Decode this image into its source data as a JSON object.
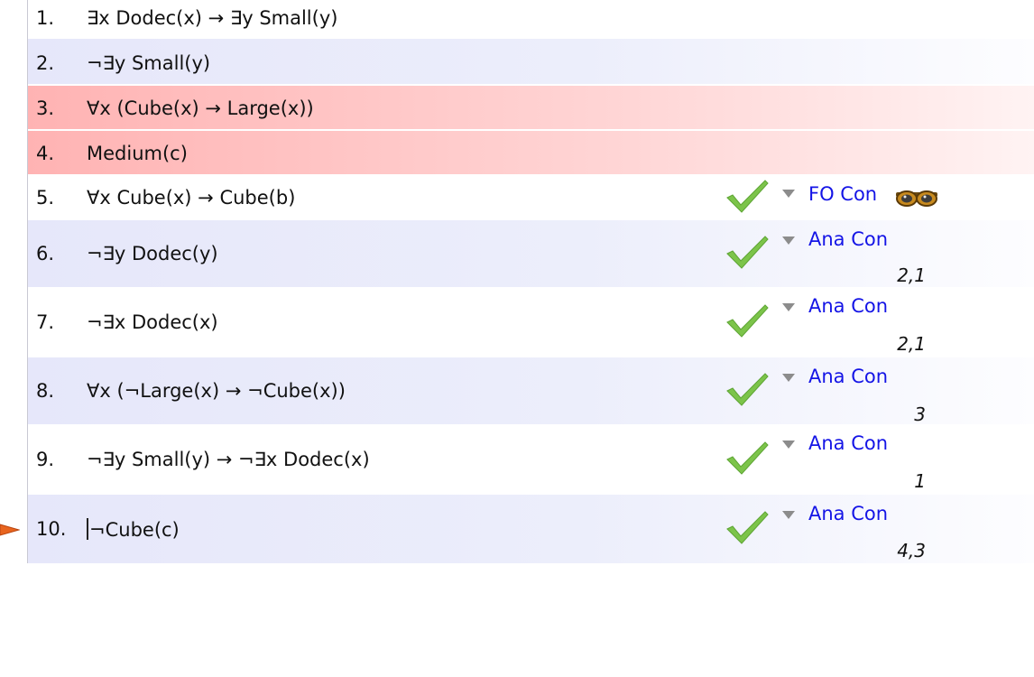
{
  "premises": [
    {
      "num": "1.",
      "sentence": "∃x Dodec(x) → ∃y Small(y)"
    },
    {
      "num": "2.",
      "sentence": "¬∃y Small(y)"
    },
    {
      "num": "3.",
      "sentence": "∀x (Cube(x) → Large(x))"
    },
    {
      "num": "4.",
      "sentence": "Medium(c)"
    }
  ],
  "steps": [
    {
      "num": "5.",
      "sentence": "∀x Cube(x) → Cube(b)",
      "rule": "FO Con",
      "support": "",
      "status": "check-icon",
      "extra_icon": "goggles-icon"
    },
    {
      "num": "6.",
      "sentence": "¬∃y Dodec(y)",
      "rule": "Ana Con",
      "support": "2,1",
      "status": "check-icon"
    },
    {
      "num": "7.",
      "sentence": "¬∃x Dodec(x)",
      "rule": "Ana Con",
      "support": "2,1",
      "status": "check-icon"
    },
    {
      "num": "8.",
      "sentence": "∀x (¬Large(x) → ¬Cube(x))",
      "rule": "Ana Con",
      "support": "3",
      "status": "check-icon"
    },
    {
      "num": "9.",
      "sentence": "¬∃y Small(y) → ¬∃x Dodec(x)",
      "rule": "Ana Con",
      "support": "1",
      "status": "check-icon"
    },
    {
      "num": "10.",
      "sentence": "¬Cube(c)",
      "rule": "Ana Con",
      "support": "4,3",
      "status": "check-icon",
      "focused": true
    }
  ],
  "colors": {
    "rule_link": "#1414e6",
    "highlight": "#ffb3b3",
    "row_alt": "#e6e7fa",
    "check": "#7cc44a",
    "pointer": "#e8641e"
  }
}
